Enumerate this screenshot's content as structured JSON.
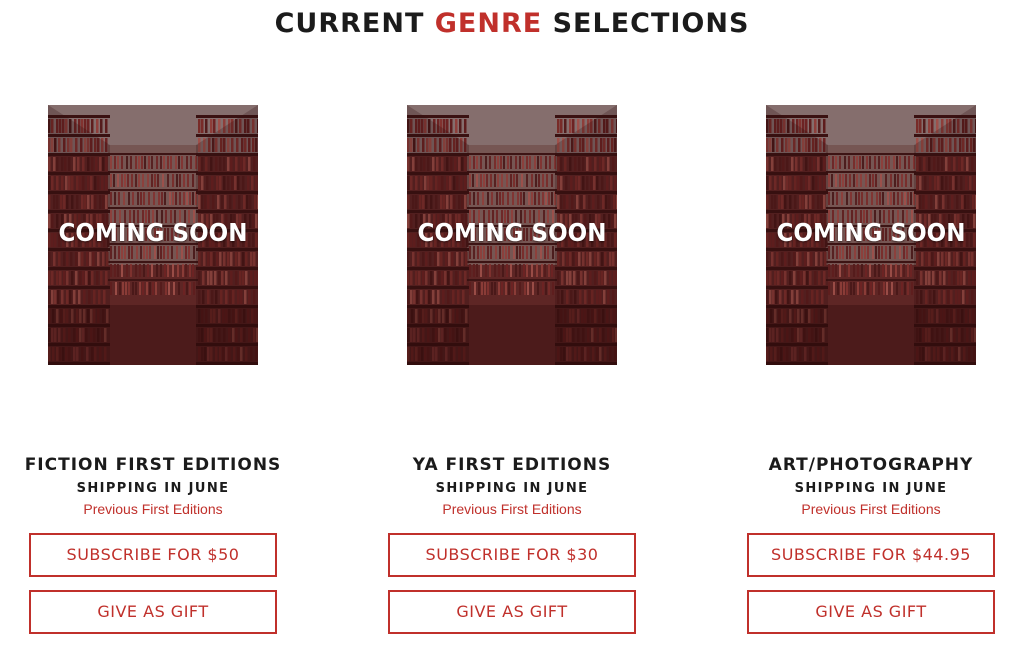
{
  "heading": {
    "part1": "CURRENT ",
    "accent": "GENRE",
    "part2": " SELECTIONS"
  },
  "colors": {
    "accent": "#c0302b",
    "text": "#1b1b1b",
    "cover_tint": "#7a3030"
  },
  "cover_label": "COMING SOON",
  "genres": [
    {
      "title": "FICTION FIRST EDITIONS",
      "shipping": "SHIPPING IN JUNE",
      "previous_link": "Previous First Editions",
      "subscribe_label": "SUBSCRIBE FOR $50",
      "gift_label": "GIVE AS GIFT"
    },
    {
      "title": "YA FIRST EDITIONS",
      "shipping": "SHIPPING IN JUNE",
      "previous_link": "Previous First Editions",
      "subscribe_label": "SUBSCRIBE FOR $30",
      "gift_label": "GIVE AS GIFT"
    },
    {
      "title": "ART/PHOTOGRAPHY",
      "shipping": "SHIPPING IN JUNE",
      "previous_link": "Previous First Editions",
      "subscribe_label": "SUBSCRIBE FOR $44.95",
      "gift_label": "GIVE AS GIFT"
    }
  ]
}
